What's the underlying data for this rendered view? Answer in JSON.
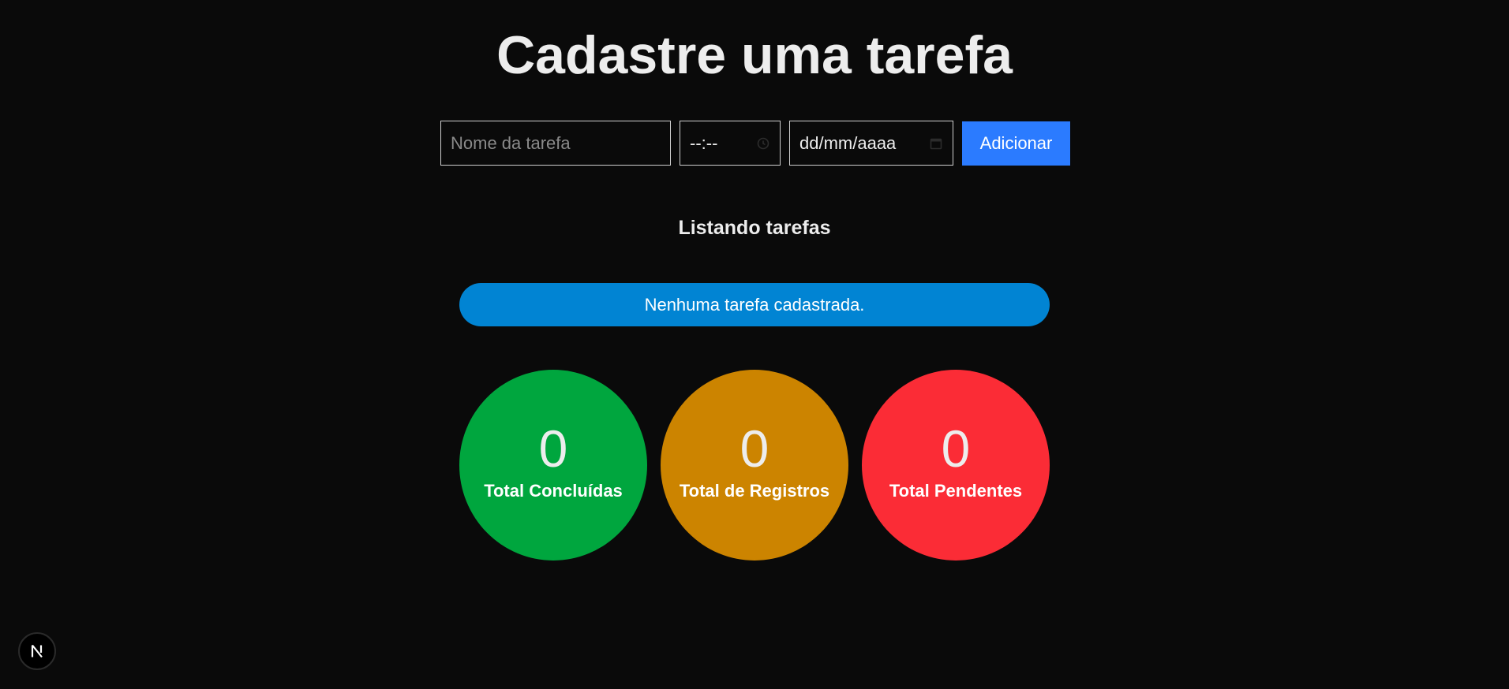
{
  "header": {
    "title": "Cadastre uma tarefa"
  },
  "form": {
    "name_placeholder": "Nome da tarefa",
    "time_value": "--:--",
    "time_icon": "clock-icon",
    "date_value": "dd/mm/aaaa",
    "date_icon": "calendar-icon",
    "add_label": "Adicionar"
  },
  "list": {
    "title": "Listando tarefas",
    "empty_message": "Nenhuma tarefa cadastrada."
  },
  "stats": [
    {
      "value": "0",
      "label": "Total Concluídas",
      "color": "#00a63e"
    },
    {
      "value": "0",
      "label": "Total de Registros",
      "color": "#cc8400"
    },
    {
      "value": "0",
      "label": "Total Pendentes",
      "color": "#fb2c36"
    }
  ],
  "colors": {
    "background": "#0a0a0a",
    "accent": "#2b7bff",
    "banner": "#0184d3"
  },
  "devtools": {
    "icon": "nextjs-logo-icon",
    "letter": "N"
  }
}
